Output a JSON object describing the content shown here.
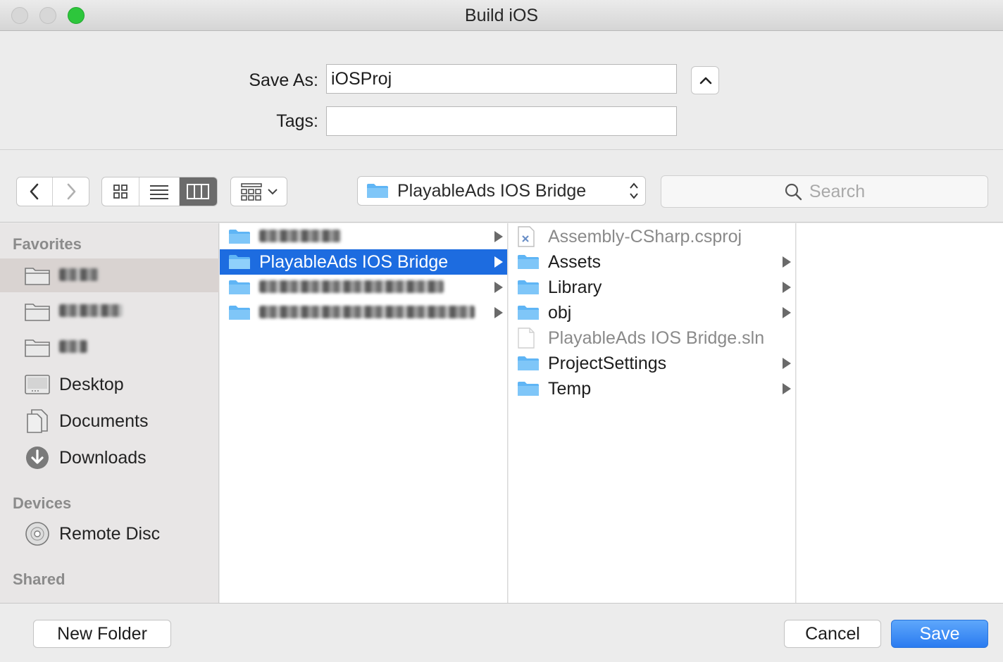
{
  "window": {
    "title": "Build iOS"
  },
  "save_form": {
    "save_as_label": "Save As:",
    "save_as_value": "iOSProj",
    "tags_label": "Tags:",
    "tags_value": ""
  },
  "toolbar": {
    "path_popup": "PlayableAds IOS Bridge",
    "search_placeholder": "Search",
    "view_mode": "columns"
  },
  "sidebar": {
    "favorites_header": "Favorites",
    "devices_header": "Devices",
    "shared_header": "Shared",
    "favorites": [
      {
        "label": "",
        "icon": "folder-icon",
        "redacted": true,
        "selected": true
      },
      {
        "label": "",
        "icon": "folder-icon",
        "redacted": true
      },
      {
        "label": "",
        "icon": "folder-icon",
        "redacted": true
      },
      {
        "label": "Desktop",
        "icon": "desktop-icon"
      },
      {
        "label": "Documents",
        "icon": "documents-icon"
      },
      {
        "label": "Downloads",
        "icon": "downloads-icon"
      }
    ],
    "devices": [
      {
        "label": "Remote Disc",
        "icon": "disc-icon"
      }
    ]
  },
  "column1": [
    {
      "label": "",
      "redacted": true,
      "folder": true
    },
    {
      "label": "PlayableAds IOS Bridge",
      "folder": true,
      "selected": true
    },
    {
      "label": "",
      "redacted": true,
      "folder": true
    },
    {
      "label": "",
      "redacted": true,
      "folder": true
    }
  ],
  "column2": [
    {
      "label": "Assembly-CSharp.csproj",
      "folder": false,
      "dim": true,
      "icon": "csproj-file-icon"
    },
    {
      "label": "Assets",
      "folder": true
    },
    {
      "label": "Library",
      "folder": true
    },
    {
      "label": "obj",
      "folder": true
    },
    {
      "label": "PlayableAds IOS Bridge.sln",
      "folder": false,
      "dim": true,
      "icon": "document-file-icon"
    },
    {
      "label": "ProjectSettings",
      "folder": true
    },
    {
      "label": "Temp",
      "folder": true
    }
  ],
  "buttons": {
    "new_folder": "New Folder",
    "cancel": "Cancel",
    "save": "Save"
  },
  "colors": {
    "selection_blue": "#1d6ce0",
    "folder_blue": "#5fb5f5",
    "primary_button": "#2a7bf0"
  }
}
